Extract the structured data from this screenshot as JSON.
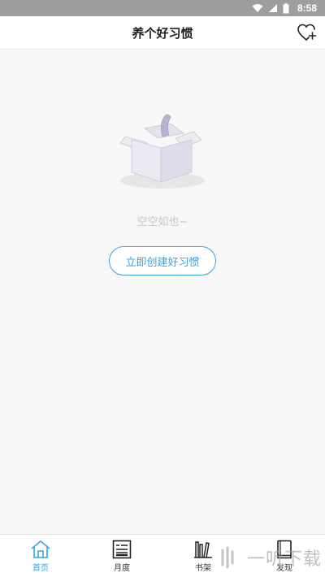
{
  "status_bar": {
    "time": "8:58",
    "icons": [
      "wifi-icon",
      "signal-icon",
      "battery-icon"
    ]
  },
  "header": {
    "title": "养个好习惯",
    "action_icon": "heart-plus-icon"
  },
  "empty_state": {
    "illustration": "empty-box-icon",
    "message": "空空如也~",
    "button_label": "立即创建好习惯"
  },
  "bottom_nav": {
    "items": [
      {
        "label": "首页",
        "icon": "home-icon",
        "active": true
      },
      {
        "label": "月度",
        "icon": "calendar-card-icon",
        "active": false
      },
      {
        "label": "书架",
        "icon": "bookshelf-icon",
        "active": false
      },
      {
        "label": "发现",
        "icon": "book-icon",
        "active": false
      }
    ]
  },
  "watermark": {
    "text": "一听下载"
  },
  "colors": {
    "accent": "#3aa3db",
    "status_bar_bg": "#9e9e9e",
    "background": "#f7f7f7",
    "empty_text": "#c9c9c9"
  }
}
